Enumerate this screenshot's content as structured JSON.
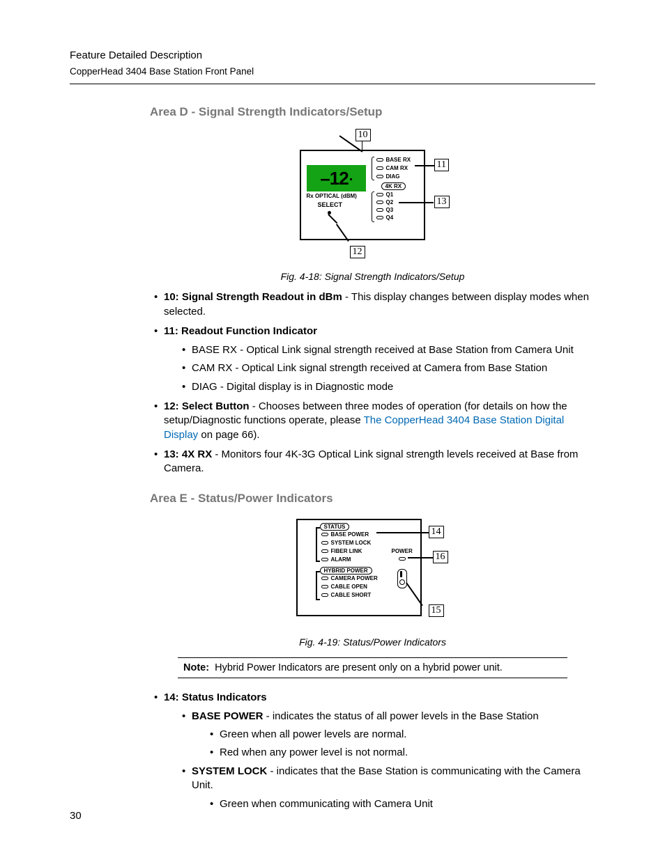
{
  "header": {
    "title": "Feature Detailed Description",
    "subtitle": "CopperHead 3404 Base Station Front Panel"
  },
  "page_number": "30",
  "area_d": {
    "heading": "Area D - Signal Strength Indicators/Setup",
    "fig_caption": "Fig. 4-18: Signal Strength Indicators/Setup",
    "diagram": {
      "readout_value": "–12",
      "rx_optical_label": "Rx OPTICAL (dBM)",
      "select_label": "SELECT",
      "leds": [
        "BASE RX",
        "CAM RX",
        "DIAG"
      ],
      "pill_4krx": "4K RX",
      "q_leds": [
        "Q1",
        "Q2",
        "Q3",
        "Q4"
      ],
      "callouts": {
        "c10": "10",
        "c11": "11",
        "c12": "12",
        "c13": "13"
      }
    },
    "bullets": {
      "b10_label": "10: Signal Strength Readout in dBm",
      "b10_text": " - This display changes between display modes when selected.",
      "b11_label": "11: Readout Function Indicator",
      "b11_sub": [
        "BASE RX - Optical Link signal strength received at Base Station from Camera Unit",
        "CAM RX - Optical Link signal strength received at Camera from Base Station",
        "DIAG - Digital display is in Diagnostic mode"
      ],
      "b12_label": "12: Select Button",
      "b12_text_a": " - Chooses between three modes of operation (for details on how the setup/Diagnostic functions operate, please ",
      "b12_link": "The CopperHead 3404 Base Station Digital Display",
      "b12_text_b": " on page 66).",
      "b13_label": "13: 4X RX",
      "b13_text": " - Monitors four 4K-3G Optical Link signal strength levels received at Base from Camera."
    }
  },
  "area_e": {
    "heading": "Area E - Status/Power Indicators",
    "fig_caption": "Fig. 4-19: Status/Power Indicators",
    "diagram": {
      "status_pill": "STATUS",
      "status_leds": [
        "BASE POWER",
        "SYSTEM LOCK",
        "FIBER LINK",
        "ALARM"
      ],
      "hybrid_pill": "HYBRID POWER",
      "hybrid_leds": [
        "CAMERA POWER",
        "CABLE OPEN",
        "CABLE SHORT"
      ],
      "power_label": "POWER",
      "callouts": {
        "c14": "14",
        "c15": "15",
        "c16": "16"
      }
    },
    "note_label": "Note:",
    "note_text": "Hybrid Power Indicators are present only on a hybrid power unit.",
    "bullets": {
      "b14_label": "14: Status Indicators",
      "bp_label": "BASE POWER",
      "bp_text": " - indicates the status of all power levels in the Base Station",
      "bp_sub": [
        "Green when all power levels are normal.",
        "Red when any power level is not normal."
      ],
      "sl_label": "SYSTEM LOCK",
      "sl_text": " - indicates that the Base Station is communicating with the Camera Unit.",
      "sl_sub": [
        "Green when communicating with Camera Unit"
      ]
    }
  }
}
